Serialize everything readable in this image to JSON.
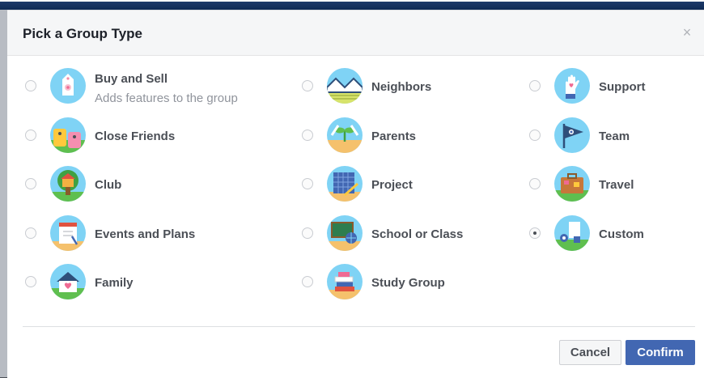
{
  "dialog": {
    "title": "Pick a Group Type",
    "close_icon": "close-icon",
    "close_glyph": "×"
  },
  "options": [
    {
      "id": "buy-and-sell",
      "label": "Buy and Sell",
      "sublabel": "Adds features to the group",
      "icon": "price-tag-icon",
      "selected": false
    },
    {
      "id": "close-friends",
      "label": "Close Friends",
      "icon": "friends-icon",
      "selected": false
    },
    {
      "id": "club",
      "label": "Club",
      "icon": "tree-house-icon",
      "selected": false
    },
    {
      "id": "events-and-plans",
      "label": "Events and Plans",
      "icon": "calendar-icon",
      "selected": false
    },
    {
      "id": "family",
      "label": "Family",
      "icon": "home-heart-icon",
      "selected": false
    },
    {
      "id": "neighbors",
      "label": "Neighbors",
      "icon": "houses-icon",
      "selected": false
    },
    {
      "id": "parents",
      "label": "Parents",
      "icon": "sprout-icon",
      "selected": false
    },
    {
      "id": "project",
      "label": "Project",
      "icon": "blueprint-icon",
      "selected": false
    },
    {
      "id": "school-or-class",
      "label": "School or Class",
      "icon": "chalkboard-icon",
      "selected": false
    },
    {
      "id": "study-group",
      "label": "Study Group",
      "icon": "books-icon",
      "selected": false
    },
    {
      "id": "support",
      "label": "Support",
      "icon": "heart-hand-icon",
      "selected": false
    },
    {
      "id": "team",
      "label": "Team",
      "icon": "pennant-flag-icon",
      "selected": false
    },
    {
      "id": "travel",
      "label": "Travel",
      "icon": "suitcase-icon",
      "selected": false
    },
    {
      "id": "custom",
      "label": "Custom",
      "icon": "custom-tools-icon",
      "selected": true
    }
  ],
  "footer": {
    "cancel_label": "Cancel",
    "confirm_label": "Confirm"
  },
  "colors": {
    "accent": "#4267b2",
    "header_bg": "#f5f6f7",
    "text": "#4b4f56",
    "subtext": "#90949c"
  }
}
